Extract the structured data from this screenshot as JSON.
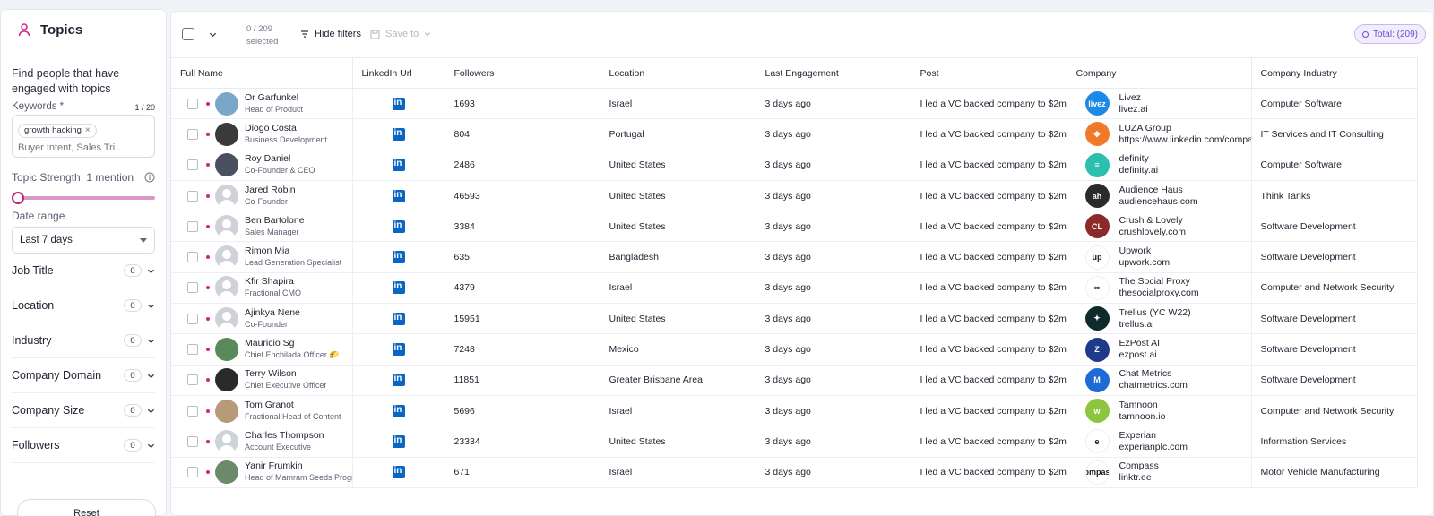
{
  "sidebar": {
    "title": "Topics",
    "description": "Find people that have engaged with topics",
    "keywords_label": "Keywords *",
    "keywords_count": "1 / 20",
    "keyword_chip": "growth hacking",
    "keyword_chip_remove": "×",
    "keyword_placeholder": "Buyer Intent, Sales Tri...",
    "strength_label": "Topic Strength: 1 mention",
    "strength_value": 1,
    "date_label": "Date range",
    "date_value": "Last 7 days",
    "filters": [
      {
        "label": "Job Title",
        "count": "0"
      },
      {
        "label": "Location",
        "count": "0"
      },
      {
        "label": "Industry",
        "count": "0"
      },
      {
        "label": "Company Domain",
        "count": "0"
      },
      {
        "label": "Company Size",
        "count": "0"
      },
      {
        "label": "Followers",
        "count": "0"
      }
    ],
    "reset_label": "Reset"
  },
  "toolbar": {
    "count_line1": "0 / 209",
    "count_line2": "selected",
    "hide_filters": "Hide filters",
    "save_to": "Save to",
    "total": "Total: (209)"
  },
  "columns": [
    "Full Name",
    "LinkedIn Url",
    "Followers",
    "Location",
    "Last Engagement",
    "Post",
    "Company",
    "Company Industry"
  ],
  "rows": [
    {
      "name": "Or Garfunkel",
      "title": "Head of Product",
      "avatar": "photo",
      "avatar_color": "#7aa7c7",
      "followers": "1693",
      "location": "Israel",
      "engagement": "3 days ago",
      "post": "I led a VC backed company to $2m",
      "company": "Livez",
      "site": "livez.ai",
      "logo_text": "livez",
      "logo_color": "#1e88e5",
      "industry": "Computer Software"
    },
    {
      "name": "Diogo Costa",
      "title": "Business Development",
      "avatar": "photo",
      "avatar_color": "#3a3a3a",
      "followers": "804",
      "location": "Portugal",
      "engagement": "3 days ago",
      "post": "I led a VC backed company to $2m",
      "company": "LUZA Group",
      "site": "https://www.linkedin.com/company",
      "logo_text": "◆",
      "logo_color": "#f07a2a",
      "industry": "IT Services and IT Consulting"
    },
    {
      "name": "Roy Daniel",
      "title": "Co-Founder & CEO",
      "avatar": "photo",
      "avatar_color": "#4a5060",
      "followers": "2486",
      "location": "United States",
      "engagement": "3 days ago",
      "post": "I led a VC backed company to $2m",
      "company": "definity",
      "site": "definity.ai",
      "logo_text": "≡",
      "logo_color": "#2bbfb0",
      "industry": "Computer Software"
    },
    {
      "name": "Jared Robin",
      "title": "Co-Founder",
      "avatar": "placeholder",
      "avatar_color": "#cfd2d8",
      "followers": "46593",
      "location": "United States",
      "engagement": "3 days ago",
      "post": "I led a VC backed company to $2m",
      "company": "Audience Haus",
      "site": "audiencehaus.com",
      "logo_text": "ah",
      "logo_color": "#2b2b2b",
      "industry": "Think Tanks"
    },
    {
      "name": "Ben Bartolone",
      "title": "Sales Manager",
      "avatar": "placeholder",
      "avatar_color": "#cfd2d8",
      "followers": "3384",
      "location": "United States",
      "engagement": "3 days ago",
      "post": "I led a VC backed company to $2m",
      "company": "Crush & Lovely",
      "site": "crushlovely.com",
      "logo_text": "CL",
      "logo_color": "#8b2a2a",
      "industry": "Software Development"
    },
    {
      "name": "Rimon Mia",
      "title": "Lead Generation Specialist",
      "avatar": "placeholder",
      "avatar_color": "#cfd2d8",
      "followers": "635",
      "location": "Bangladesh",
      "engagement": "3 days ago",
      "post": "I led a VC backed company to $2m",
      "company": "Upwork",
      "site": "upwork.com",
      "logo_text": "up",
      "logo_color": "#ffffff",
      "industry": "Software Development"
    },
    {
      "name": "Kfir Shapira",
      "title": "Fractional CMO",
      "avatar": "placeholder",
      "avatar_color": "#cfd2d8",
      "followers": "4379",
      "location": "Israel",
      "engagement": "3 days ago",
      "post": "I led a VC backed company to $2m",
      "company": "The Social Proxy",
      "site": "thesocialproxy.com",
      "logo_text": "∞",
      "logo_color": "#ffffff",
      "industry": "Computer and Network Security"
    },
    {
      "name": "Ajinkya Nene",
      "title": "Co-Founder",
      "avatar": "placeholder",
      "avatar_color": "#cfd2d8",
      "followers": "15951",
      "location": "United States",
      "engagement": "3 days ago",
      "post": "I led a VC backed company to $2m",
      "company": "Trellus (YC W22)",
      "site": "trellus.ai",
      "logo_text": "✦",
      "logo_color": "#0f2a2a",
      "industry": "Software Development"
    },
    {
      "name": "Mauricio Sg",
      "title": "Chief Enchilada Officer 🌮",
      "avatar": "photo",
      "avatar_color": "#5a8a5a",
      "followers": "7248",
      "location": "Mexico",
      "engagement": "3 days ago",
      "post": "I led a VC backed company to $2m",
      "company": "EzPost AI",
      "site": "ezpost.ai",
      "logo_text": "Z",
      "logo_color": "#1f3a8a",
      "industry": "Software Development"
    },
    {
      "name": "Terry Wilson",
      "title": "Chief Executive Officer",
      "avatar": "photo",
      "avatar_color": "#2a2a2a",
      "followers": "11851",
      "location": "Greater Brisbane Area",
      "engagement": "3 days ago",
      "post": "I led a VC backed company to $2m",
      "company": "Chat Metrics",
      "site": "chatmetrics.com",
      "logo_text": "M",
      "logo_color": "#1e6ad6",
      "industry": "Software Development"
    },
    {
      "name": "Tom Granot",
      "title": "Fractional Head of Content",
      "avatar": "photo",
      "avatar_color": "#b89a7a",
      "followers": "5696",
      "location": "Israel",
      "engagement": "3 days ago",
      "post": "I led a VC backed company to $2m",
      "company": "Tamnoon",
      "site": "tamnoon.io",
      "logo_text": "w",
      "logo_color": "#8cc63f",
      "industry": "Computer and Network Security"
    },
    {
      "name": "Charles Thompson",
      "title": "Account Executive",
      "avatar": "placeholder",
      "avatar_color": "#cfd2d8",
      "followers": "23334",
      "location": "United States",
      "engagement": "3 days ago",
      "post": "I led a VC backed company to $2m",
      "company": "Experian",
      "site": "experianplc.com",
      "logo_text": "e",
      "logo_color": "#ffffff",
      "industry": "Information Services"
    },
    {
      "name": "Yanir Frumkin",
      "title": "Head of Mamram Seeds Progra",
      "avatar": "photo",
      "avatar_color": "#6b8a6b",
      "followers": "671",
      "location": "Israel",
      "engagement": "3 days ago",
      "post": "I led a VC backed company to $2m",
      "company": "Compass",
      "site": "linktr.ee",
      "logo_text": "compass",
      "logo_color": "#ffffff",
      "industry": "Motor Vehicle Manufacturing"
    }
  ]
}
